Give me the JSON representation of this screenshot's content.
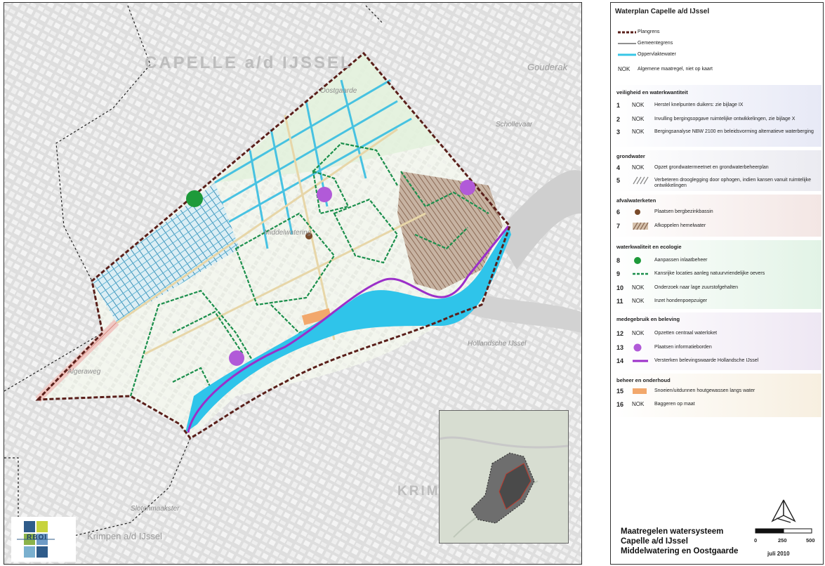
{
  "map": {
    "city_labels": {
      "capelle": "CAPELLE a/d IJSSEL",
      "krimpen_big": "KRIMPEN a/d IJSSEL",
      "krimpen_small": "Krimpen a/d IJssel",
      "gouderak": "Gouderak"
    },
    "road_labels": [
      "Algeraweg",
      "Slotenmaakster",
      "Middelwatering",
      "Oostgaarde",
      "Schollevaar",
      "Hollandsche IJssel"
    ],
    "logo_text": "RBOI"
  },
  "legend": {
    "title": "Waterplan Capelle a/d IJssel",
    "general": [
      {
        "sym": "plangrens",
        "label": "Plangrens"
      },
      {
        "sym": "gemeentegrens",
        "label": "Gemeentegrens"
      },
      {
        "sym": "water",
        "label": "Oppervlaktewater"
      },
      {
        "code": "NOK",
        "label": "Algemene maatregel, niet op kaart"
      }
    ],
    "sections": [
      {
        "heading": "veiligheid en waterkwantiteit",
        "color": "#e7e9f6",
        "items": [
          {
            "num": "1",
            "code": "NOK",
            "label": "Herstel knelpunten duikers: zie bijlage IX"
          },
          {
            "num": "2",
            "code": "NOK",
            "label": "Invulling bergingsopgave ruimtelijke ontwikkelingen, zie bijlage X"
          },
          {
            "num": "3",
            "code": "NOK",
            "label": "Bergingsanalyse NBW 2100 en beleidsvorming alternatieve waterberging"
          }
        ]
      },
      {
        "heading": "grondwater",
        "color": "#ebebf1",
        "items": [
          {
            "num": "4",
            "code": "NOK",
            "label": "Opzet grondwatermeetnet en grondwaterbeheerplan"
          },
          {
            "num": "5",
            "sym": "hatch-grey",
            "label": "Verbeteren drooglegging door ophogen, indien kansen vanuit ruimtelijke ontwikkelingen"
          }
        ]
      },
      {
        "heading": "afvalwaterketen",
        "color": "#f3e6e4",
        "items": [
          {
            "num": "6",
            "sym": "dot-brown",
            "label": "Plaatsen bergbezinkbassin"
          },
          {
            "num": "7",
            "sym": "hatch-brown",
            "label": "Afkoppelen hemelwater"
          }
        ]
      },
      {
        "heading": "waterkwaliteit en ecologie",
        "color": "#e2f3e6",
        "items": [
          {
            "num": "8",
            "sym": "dot-green",
            "label": "Aanpassen inlaatbeheer"
          },
          {
            "num": "9",
            "sym": "dash-green",
            "label": "Kansrijke locaties aanleg natuurvriendelijke oevers"
          },
          {
            "num": "10",
            "code": "NOK",
            "label": "Onderzoek naar lage zuurstofgehalten"
          },
          {
            "num": "11",
            "code": "NOK",
            "label": "Inzet hondenpoepzuiger"
          }
        ]
      },
      {
        "heading": "medegebruik en beleving",
        "color": "#eee7f3",
        "items": [
          {
            "num": "12",
            "code": "NOK",
            "label": "Opzetten centraal waterloket"
          },
          {
            "num": "13",
            "sym": "dot-purple",
            "label": "Plaatsen informatieborden"
          },
          {
            "num": "14",
            "sym": "line-purple",
            "label": "Versterken belevingswaarde Hollandsche IJssel"
          }
        ]
      },
      {
        "heading": "beheer en onderhoud",
        "color": "#f7efe0",
        "items": [
          {
            "num": "15",
            "sym": "rect-orange",
            "label": "Snoeien/uitdunnen houtgewassen langs water"
          },
          {
            "num": "16",
            "code": "NOK",
            "label": "Baggeren op maat"
          }
        ]
      }
    ],
    "footer": {
      "title_lines": [
        "Maatregelen watersysteem",
        "Capelle a/d IJssel",
        "Middelwatering en Oostgaarde"
      ],
      "scale_labels": [
        "0",
        "250",
        "500"
      ],
      "date": "juli 2010"
    }
  },
  "colors": {
    "plangrens": "#5a1f1a",
    "water": "#38c6e6",
    "green": "#1b8f4c",
    "purple": "#a64bd2",
    "brown": "#7a4a2a",
    "orange": "#f2a86c"
  }
}
